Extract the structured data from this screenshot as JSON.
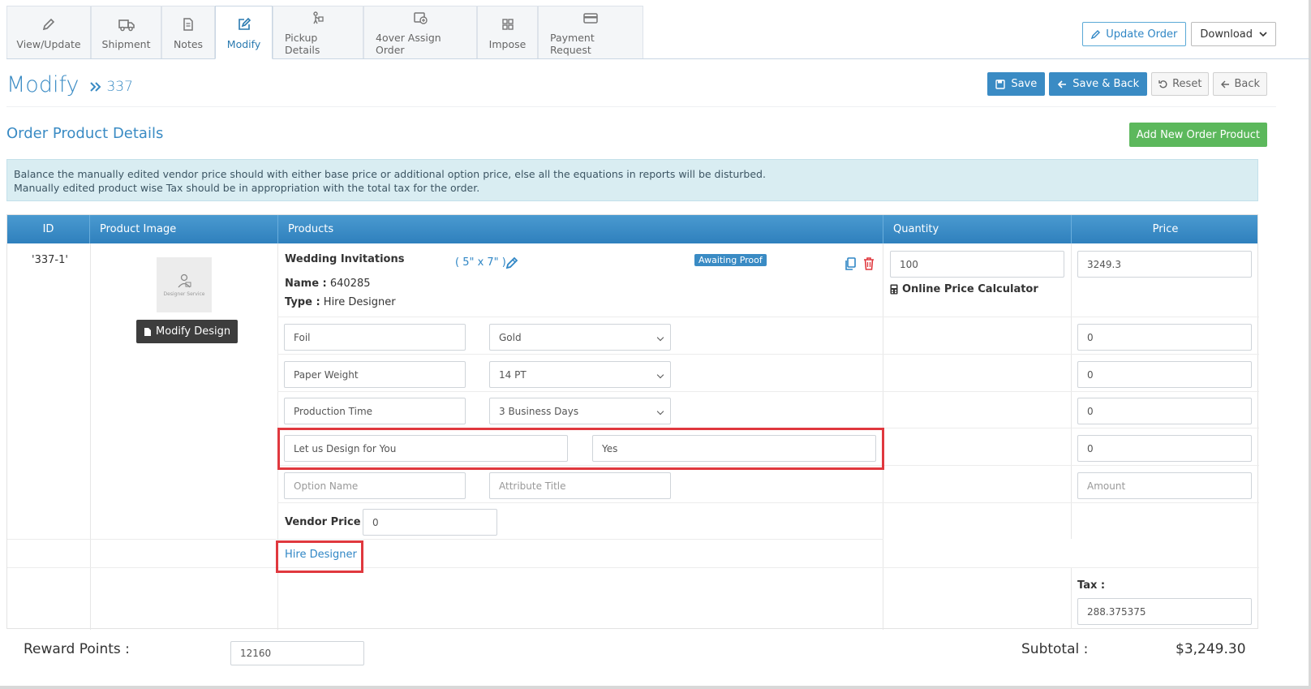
{
  "tabs": [
    {
      "label": "View/Update",
      "icon": "pencil-icon"
    },
    {
      "label": "Shipment",
      "icon": "truck-icon"
    },
    {
      "label": "Notes",
      "icon": "document-icon"
    },
    {
      "label": "Modify",
      "icon": "edit-icon",
      "active": true
    },
    {
      "label": "Pickup Details",
      "icon": "pickup-icon"
    },
    {
      "label": "4over Assign Order",
      "icon": "assign-icon"
    },
    {
      "label": "Impose",
      "icon": "grid-icon"
    },
    {
      "label": "Payment Request",
      "icon": "card-icon"
    }
  ],
  "top_actions": {
    "update_order": "Update Order",
    "download": "Download"
  },
  "header": {
    "title": "Modify",
    "order_id": "337"
  },
  "header_actions": {
    "save": "Save",
    "save_back": "Save & Back",
    "reset": "Reset",
    "back": "Back"
  },
  "section": {
    "title": "Order Product Details",
    "add_button": "Add New Order Product"
  },
  "alert": {
    "line1": "Balance the manually edited vendor price should with either base price or additional option price, else all the equations in reports will be disturbed.",
    "line2": "Manually edited product wise Tax should be in appropriation with the total tax for the order."
  },
  "table": {
    "headers": {
      "id": "ID",
      "image": "Product Image",
      "products": "Products",
      "quantity": "Quantity",
      "price": "Price"
    },
    "row": {
      "id": "'337-1'",
      "thumb_caption": "Designer Service",
      "modify_design": "Modify Design",
      "product_name": "Wedding Invitations",
      "size": "( 5\" x 7\" )",
      "status": "Awaiting Proof",
      "name_label": "Name :",
      "name_value": "640285",
      "type_label": "Type :",
      "type_value": "Hire Designer",
      "quantity": "100",
      "calculator": "Online Price Calculator",
      "price": "3249.3",
      "options": [
        {
          "name": "Foil",
          "value": "Gold",
          "price": "0"
        },
        {
          "name": "Paper Weight",
          "value": "14 PT",
          "price": "0"
        },
        {
          "name": "Production Time",
          "value": "3 Business Days",
          "price": "0"
        },
        {
          "name": "Let us Design for You",
          "value": "Yes",
          "price": "0"
        }
      ],
      "new_option": {
        "name_placeholder": "Option Name",
        "attr_placeholder": "Attribute Title",
        "amount_placeholder": "Amount"
      },
      "vendor_price_label": "Vendor Price :",
      "vendor_price": "0",
      "hire_designer_link": "Hire Designer",
      "tax_label": "Tax :",
      "tax_value": "288.375375"
    }
  },
  "footer": {
    "reward_label": "Reward Points :",
    "reward_value": "12160",
    "subtotal_label": "Subtotal :",
    "subtotal_value": "$3,249.30"
  },
  "colors": {
    "accent": "#3a8bc4",
    "success": "#5cb85c",
    "highlight": "#e0383e",
    "header_bar": "#2f80bd"
  }
}
